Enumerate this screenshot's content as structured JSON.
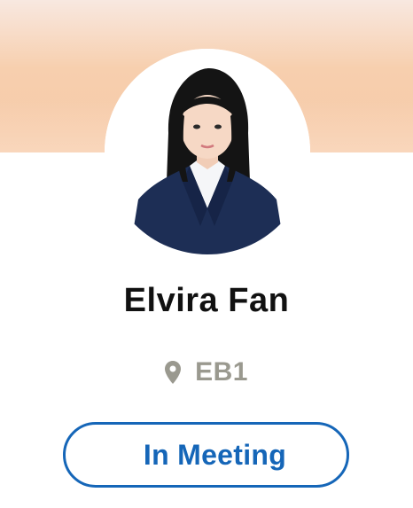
{
  "profile": {
    "name": "Elvira Fan",
    "location": "EB1",
    "status": "In Meeting"
  },
  "icons": {
    "location": "map-pin-icon"
  },
  "colors": {
    "banner_top": "#f8e8e0",
    "banner_bottom": "#f6c9a8",
    "name_text": "#111111",
    "location_text": "#9a998f",
    "status_accent": "#1566b8"
  }
}
